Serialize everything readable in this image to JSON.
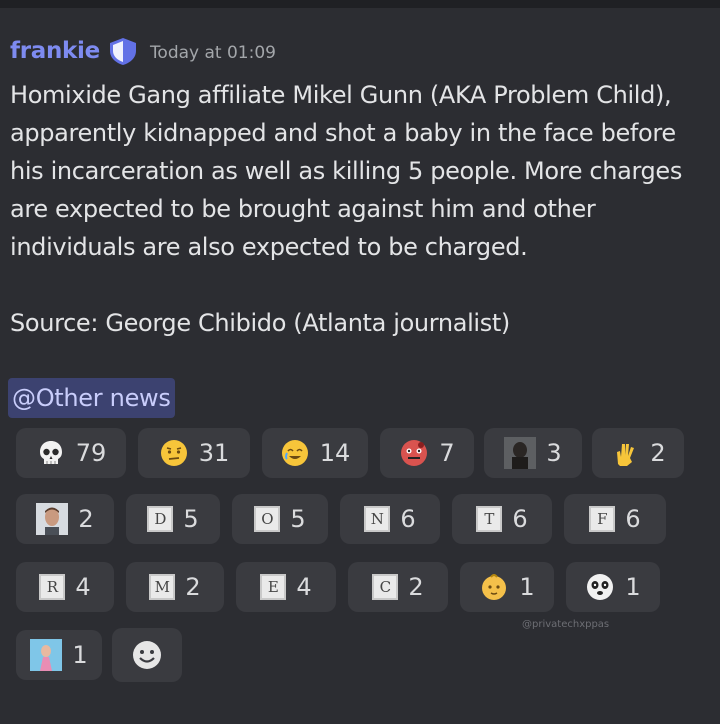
{
  "message": {
    "author": "frankie",
    "timestamp": "Today at 01:09",
    "body": "Homixide Gang affiliate Mikel Gunn (AKA Problem Child),\napparently kidnapped and shot a baby in the face before\nhis incarceration as well as killing 5 people. More charges\nare expected to be brought against him and other\nindividuals are also expected to be charged.",
    "source": "Source: George Chibido (Atlanta journalist)",
    "mention": "@Other news"
  },
  "reactions": [
    {
      "icon": "skull-emoji",
      "count": "79"
    },
    {
      "icon": "grimace-emoji",
      "count": "31"
    },
    {
      "icon": "teary-smile-emoji",
      "count": "14"
    },
    {
      "icon": "bloody-face-emoji",
      "count": "7"
    },
    {
      "icon": "person-photo-emoji",
      "count": "3"
    },
    {
      "icon": "vulcan-hand-emoji",
      "count": "2"
    },
    {
      "icon": "man-photo-emoji",
      "count": "2"
    },
    {
      "letter": "D",
      "count": "5"
    },
    {
      "letter": "O",
      "count": "5"
    },
    {
      "letter": "N",
      "count": "6"
    },
    {
      "letter": "T",
      "count": "6"
    },
    {
      "letter": "F",
      "count": "6"
    },
    {
      "letter": "R",
      "count": "4"
    },
    {
      "letter": "M",
      "count": "2"
    },
    {
      "letter": "E",
      "count": "4"
    },
    {
      "letter": "C",
      "count": "2"
    },
    {
      "icon": "baby-emoji",
      "count": "1"
    },
    {
      "icon": "panda-face-emoji",
      "count": "1"
    },
    {
      "icon": "person-photo-emoji",
      "count": "1"
    }
  ],
  "watermark": "@privatechxppas",
  "colors": {
    "author": "#7e8bf0",
    "mention_bg": "#3c4270",
    "pill_bg": "#3a3b40",
    "background": "#2c2d32"
  }
}
